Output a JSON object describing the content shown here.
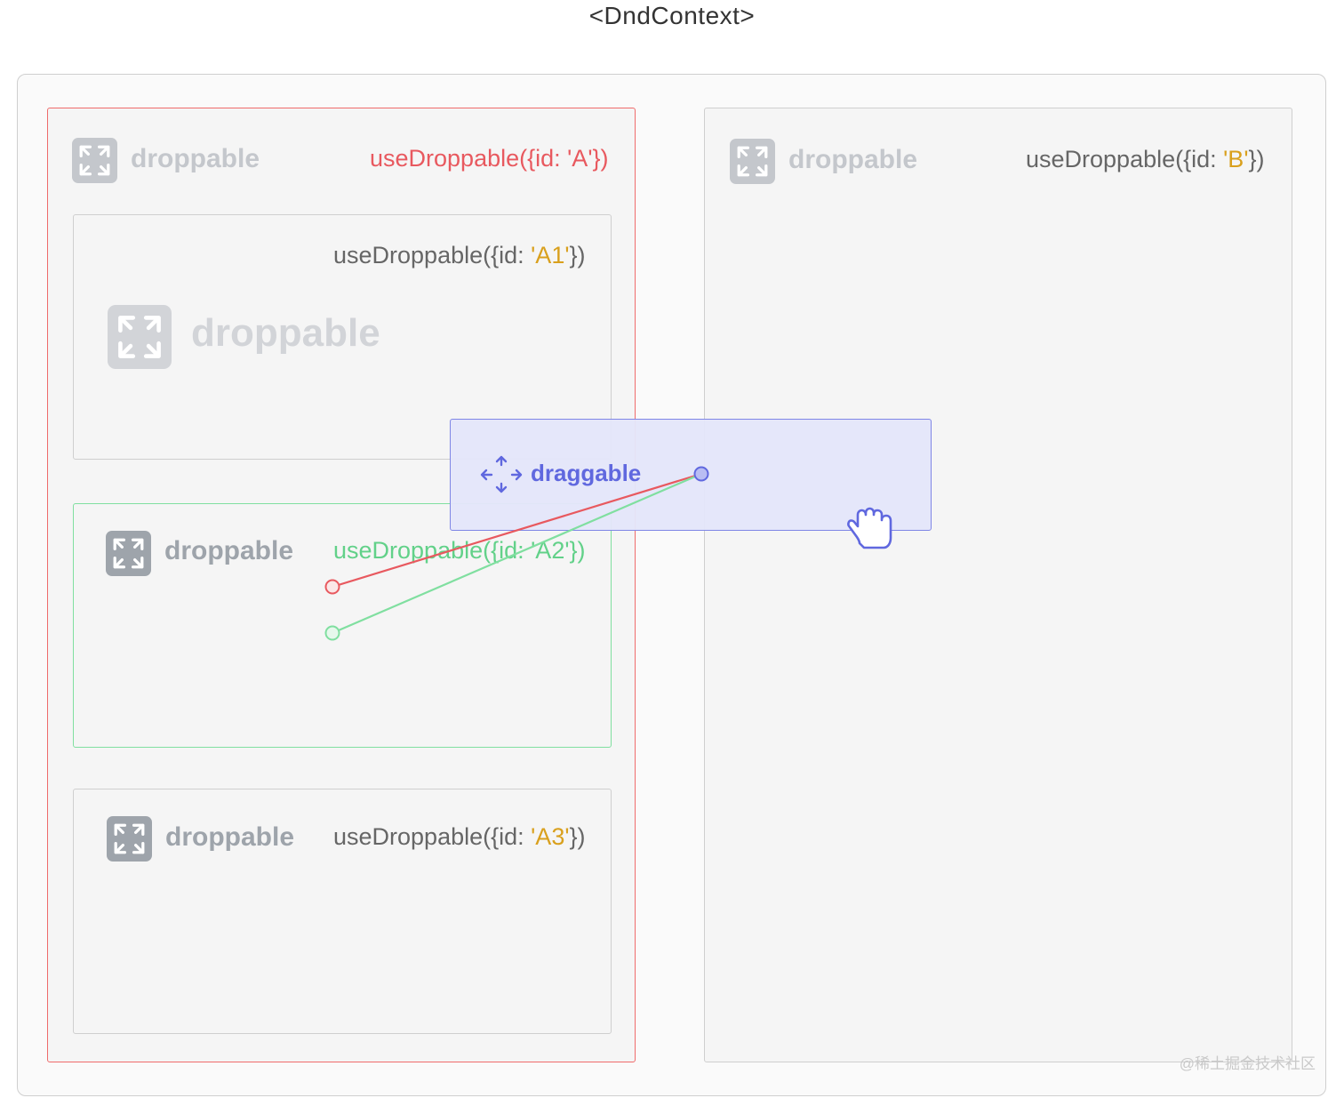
{
  "context_title": "<DndContext>",
  "colors": {
    "active_red": "#e8595f",
    "over_green": "#62d189",
    "draggable_blue": "#6068df",
    "id_gold": "#d9a01d"
  },
  "droppables": {
    "A": {
      "label": "droppable",
      "hook_prefix": "useDroppable({id: ",
      "id": "'A'",
      "hook_suffix": "})"
    },
    "B": {
      "label": "droppable",
      "hook_prefix": "useDroppable({id: ",
      "id": "'B'",
      "hook_suffix": "})"
    },
    "A1": {
      "label": "droppable",
      "hook_prefix": "useDroppable({id: ",
      "id": "'A1'",
      "hook_suffix": "})"
    },
    "A2": {
      "label": "droppable",
      "hook_prefix": "useDroppable({id: ",
      "id": "'A2'",
      "hook_suffix": "})"
    },
    "A3": {
      "label": "droppable",
      "hook_prefix": "useDroppable({id: ",
      "id": "'A3'",
      "hook_suffix": "})"
    }
  },
  "draggable": {
    "label": "draggable",
    "icon": "move-arrows-icon",
    "cursor": "grab-hand-icon"
  },
  "watermark": "@稀土掘金技术社区"
}
